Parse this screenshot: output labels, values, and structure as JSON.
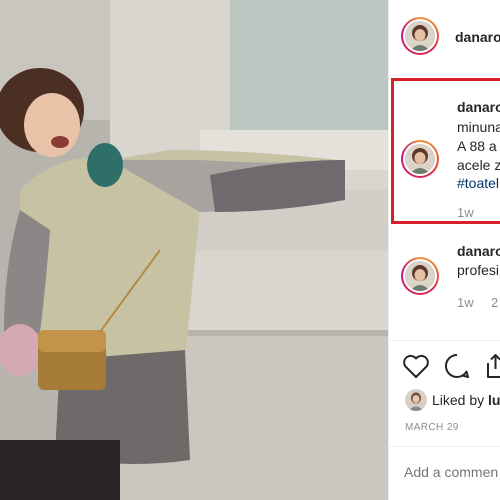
{
  "post": {
    "author": "danaro",
    "image_alt": ""
  },
  "comments": [
    {
      "username": "danaro",
      "lines": [
        "minuna",
        "A 88 a",
        "acele z"
      ],
      "hashtag": "#toatel",
      "time": "1w"
    },
    {
      "username": "danaro",
      "lines": [
        "profesi"
      ],
      "time": "1w",
      "likes": "2"
    }
  ],
  "actions": {
    "like_icon": "heart-icon",
    "comment_icon": "comment-icon",
    "share_icon": "share-icon"
  },
  "likes": {
    "prefix": "Liked by",
    "name": "lu"
  },
  "date": "MARCH 29",
  "add_comment_placeholder": "Add a commen",
  "colors": {
    "highlight": "#d8202b",
    "hashtag": "#00376b",
    "muted": "#8e8e8e"
  }
}
